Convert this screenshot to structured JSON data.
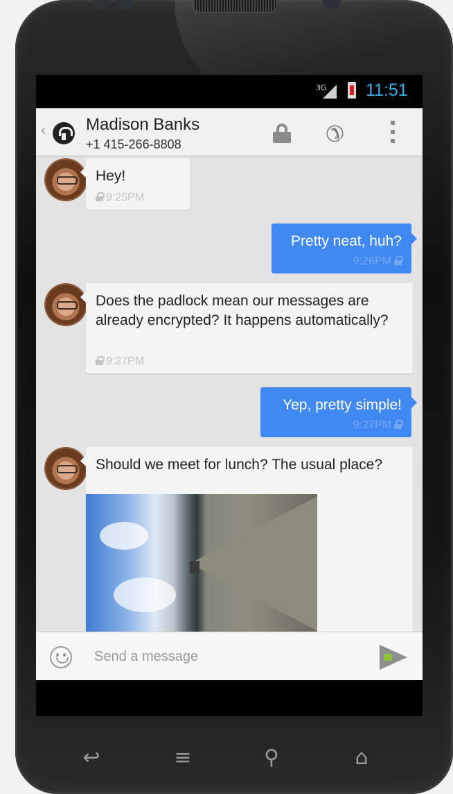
{
  "status_bar": {
    "network_type": "3G",
    "time": "11:51",
    "colors": {
      "clock": "#35b0e8",
      "battery_low": "#e01b1b"
    }
  },
  "action_bar": {
    "contact_name": "Madison Banks",
    "contact_number": "+1 415-266-8808",
    "icons": [
      "app-logo-icon",
      "lock-icon",
      "phone-icon",
      "overflow-menu-icon"
    ]
  },
  "messages": [
    {
      "direction": "incoming",
      "text": "Hey!",
      "time": "9:25PM",
      "encrypted": true
    },
    {
      "direction": "outgoing",
      "text": "Pretty neat, huh?",
      "time": "9:26PM",
      "encrypted": true
    },
    {
      "direction": "incoming",
      "text": "Does the padlock mean our messages are already encrypted? It happens automatically?",
      "time": "9:27PM",
      "encrypted": true
    },
    {
      "direction": "outgoing",
      "text": "Yep, pretty simple!",
      "time": "9:27PM",
      "encrypted": true
    },
    {
      "direction": "incoming",
      "text": "Should we meet for lunch? The usual place?",
      "attachment": "photo",
      "encrypted": true
    }
  ],
  "compose": {
    "placeholder": "Send a message",
    "value": ""
  },
  "theme": {
    "incoming_bubble": "#f4f4f4",
    "outgoing_bubble": "#4189f2",
    "send_accent": "#8ec43d"
  },
  "nav_keys": [
    "back-icon",
    "menu-icon",
    "search-icon",
    "home-icon"
  ]
}
